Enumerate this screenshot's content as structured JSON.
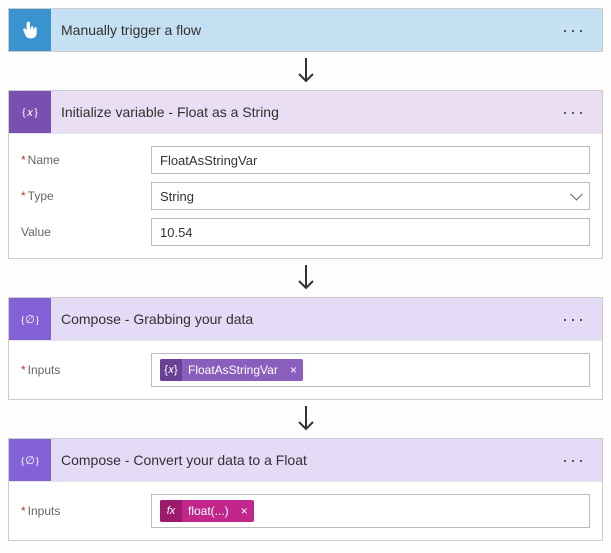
{
  "actions": {
    "trigger": {
      "title": "Manually trigger a flow"
    },
    "initVar": {
      "title": "Initialize variable - Float as a String",
      "fields": {
        "nameLabel": "Name",
        "nameValue": "FloatAsStringVar",
        "typeLabel": "Type",
        "typeValue": "String",
        "valueLabel": "Value",
        "valueValue": "10.54"
      }
    },
    "compose1": {
      "title": "Compose - Grabbing your data",
      "inputsLabel": "Inputs",
      "token": "FloatAsStringVar"
    },
    "compose2": {
      "title": "Compose - Convert your data to a Float",
      "inputsLabel": "Inputs",
      "token": "float(...)"
    }
  },
  "glyphs": {
    "menu": "···",
    "tokenClose": "×"
  }
}
